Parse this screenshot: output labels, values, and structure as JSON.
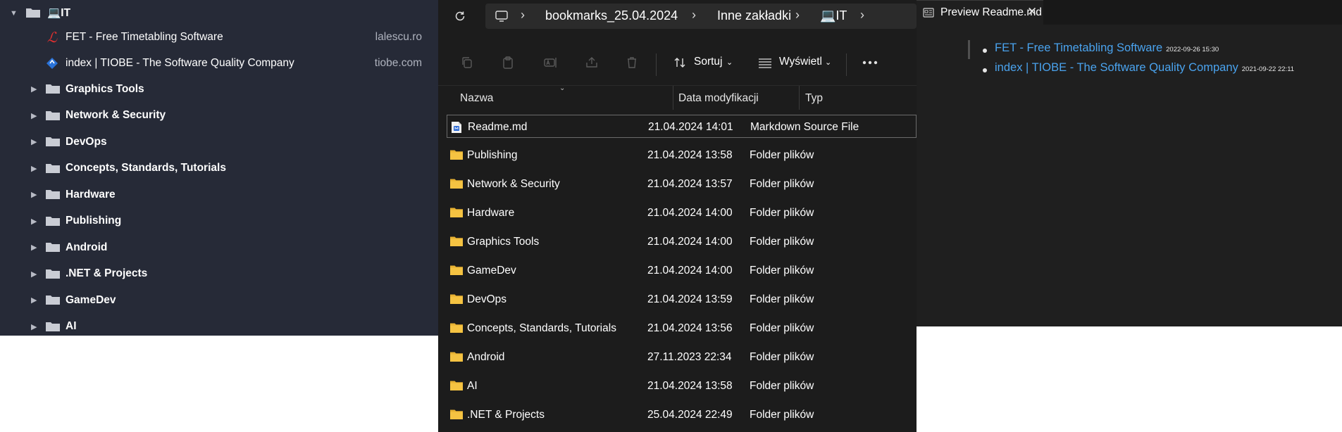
{
  "bookmarks": {
    "root": {
      "label": "💻IT"
    },
    "links": [
      {
        "label": "FET - Free Timetabling Software",
        "domain": "lalescu.ro",
        "icon": "fet-logo-icon"
      },
      {
        "label": "index | TIOBE - The Software Quality Company",
        "domain": "tiobe.com",
        "icon": "tiobe-logo-icon"
      }
    ],
    "folders": [
      {
        "label": "Graphics Tools"
      },
      {
        "label": "Network & Security"
      },
      {
        "label": "DevOps"
      },
      {
        "label": "Concepts, Standards, Tutorials"
      },
      {
        "label": "Hardware"
      },
      {
        "label": "Publishing"
      },
      {
        "label": "Android"
      },
      {
        "label": ".NET & Projects"
      },
      {
        "label": "GameDev"
      },
      {
        "label": "AI"
      }
    ]
  },
  "explorer": {
    "breadcrumb": [
      "bookmarks_25.04.2024",
      "Inne zakładki",
      "💻IT"
    ],
    "toolbar": {
      "sort_label": "Sortuj",
      "view_label": "Wyświetl"
    },
    "columns": {
      "name": "Nazwa",
      "date": "Data modyfikacji",
      "type": "Typ"
    },
    "files": [
      {
        "name": "Readme.md",
        "date": "21.04.2024 14:01",
        "type": "Markdown Source File",
        "kind": "file"
      },
      {
        "name": "Publishing",
        "date": "21.04.2024 13:58",
        "type": "Folder plików",
        "kind": "folder"
      },
      {
        "name": "Network & Security",
        "date": "21.04.2024 13:57",
        "type": "Folder plików",
        "kind": "folder"
      },
      {
        "name": "Hardware",
        "date": "21.04.2024 14:00",
        "type": "Folder plików",
        "kind": "folder"
      },
      {
        "name": "Graphics Tools",
        "date": "21.04.2024 14:00",
        "type": "Folder plików",
        "kind": "folder"
      },
      {
        "name": "GameDev",
        "date": "21.04.2024 14:00",
        "type": "Folder plików",
        "kind": "folder"
      },
      {
        "name": "DevOps",
        "date": "21.04.2024 13:59",
        "type": "Folder plików",
        "kind": "folder"
      },
      {
        "name": "Concepts, Standards, Tutorials",
        "date": "21.04.2024 13:56",
        "type": "Folder plików",
        "kind": "folder"
      },
      {
        "name": "Android",
        "date": "27.11.2023 22:34",
        "type": "Folder plików",
        "kind": "folder"
      },
      {
        "name": "AI",
        "date": "21.04.2024 13:58",
        "type": "Folder plików",
        "kind": "folder"
      },
      {
        "name": ".NET & Projects",
        "date": "25.04.2024 22:49",
        "type": "Folder plików",
        "kind": "folder"
      }
    ]
  },
  "preview": {
    "tab_title": "Preview Readme.md",
    "items": [
      {
        "link": "FET - Free Timetabling Software",
        "timestamp": "2022-09-26 15:30"
      },
      {
        "link": "index | TIOBE - The Software Quality Company",
        "timestamp": "2021-09-22 22:11"
      }
    ]
  },
  "colors": {
    "bookmarks_bg": "#262a37",
    "explorer_bg": "#1c1c1c",
    "preview_bg": "#1f1f1f",
    "link": "#4aa3ee",
    "folder": "#f5c342"
  }
}
